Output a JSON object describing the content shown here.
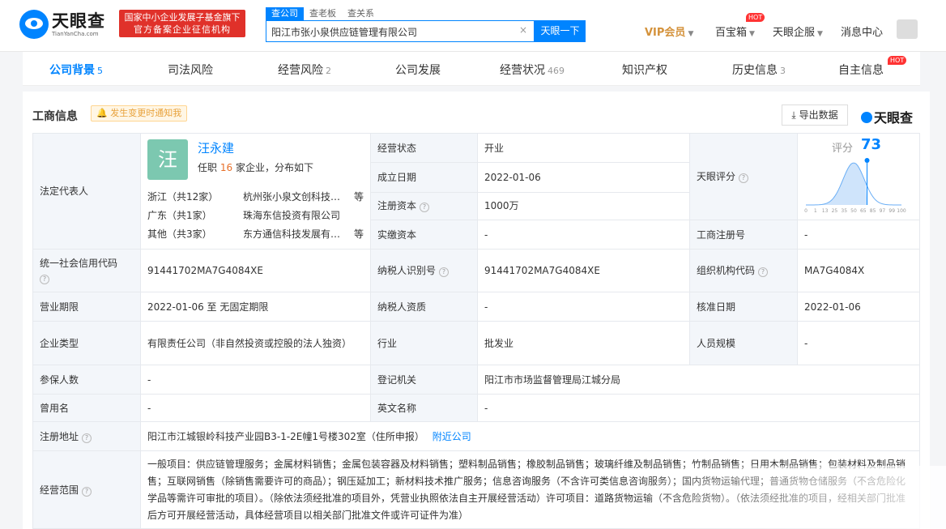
{
  "header": {
    "logo_text": "天眼查",
    "logo_sub": "TianYanCha.com",
    "badge_line1": "国家中小企业发展子基金旗下",
    "badge_line2": "官方备案企业征信机构",
    "search_tabs": [
      "查公司",
      "查老板",
      "查关系"
    ],
    "search_value": "阳江市张小泉供应链管理有限公司",
    "search_clear": "×",
    "search_button": "天眼一下",
    "vip": "VIP会员",
    "baibaoxiang": "百宝箱",
    "hot": "HOT",
    "qiye": "天眼企服",
    "messages": "消息中心"
  },
  "tabs": [
    {
      "label": "公司背景",
      "count": "5"
    },
    {
      "label": "司法风险",
      "count": ""
    },
    {
      "label": "经营风险",
      "count": "2"
    },
    {
      "label": "公司发展",
      "count": ""
    },
    {
      "label": "经营状况",
      "count": "469"
    },
    {
      "label": "知识产权",
      "count": ""
    },
    {
      "label": "历史信息",
      "count": "3"
    },
    {
      "label": "自主信息",
      "count": ""
    }
  ],
  "section": {
    "title": "工商信息",
    "notify": "发生变更时通知我",
    "export": "导出数据",
    "brand": "天眼查"
  },
  "legal": {
    "label": "法定代表人",
    "avatar_char": "汪",
    "name": "汪永建",
    "sub_prefix": "任职",
    "sub_count": "16",
    "sub_suffix": "家企业，分布如下",
    "rows": [
      {
        "region": "浙江（共12家）",
        "company": "杭州张小泉文创科技有限公司",
        "etc": "等"
      },
      {
        "region": "广东（共1家）",
        "company": "珠海东信投资有限公司",
        "etc": ""
      },
      {
        "region": "其他（共3家）",
        "company": "东方通信科技发展有限公司",
        "etc": "等"
      }
    ]
  },
  "score": {
    "label": "天眼评分",
    "title": "评分",
    "value": 73,
    "ticks": [
      "0",
      "1",
      "13",
      "25",
      "35",
      "50",
      "65",
      "85",
      "97",
      "99",
      "100"
    ]
  },
  "fields": {
    "status_l": "经营状态",
    "status_v": "开业",
    "founded_l": "成立日期",
    "founded_v": "2022-01-06",
    "capital_l": "注册资本",
    "capital_v": "1000万",
    "paid_l": "实缴资本",
    "paid_v": "-",
    "regno_l": "工商注册号",
    "regno_v": "-",
    "credit_l": "统一社会信用代码",
    "credit_v": "91441702MA7G4084XE",
    "taxid_l": "纳税人识别号",
    "taxid_v": "91441702MA7G4084XE",
    "org_l": "组织机构代码",
    "org_v": "MA7G4084X",
    "term_l": "营业期限",
    "term_v": "2022-01-06 至 无固定期限",
    "taxq_l": "纳税人资质",
    "taxq_v": "-",
    "approve_l": "核准日期",
    "approve_v": "2022-01-06",
    "type_l": "企业类型",
    "type_v": "有限责任公司（非自然投资或控股的法人独资）",
    "industry_l": "行业",
    "industry_v": "批发业",
    "staff_l": "人员规模",
    "staff_v": "-",
    "insured_l": "参保人数",
    "insured_v": "-",
    "regauth_l": "登记机关",
    "regauth_v": "阳江市市场监督管理局江城分局",
    "former_l": "曾用名",
    "former_v": "-",
    "en_l": "英文名称",
    "en_v": "-",
    "addr_l": "注册地址",
    "addr_v": "阳江市江城银岭科技产业园B3-1-2E幢1号楼302室（住所申报）",
    "addr_link": "附近公司",
    "scope_l": "经营范围",
    "scope_v": "一般项目：供应链管理服务；金属材料销售；金属包装容器及材料销售；塑料制品销售；橡胶制品销售；玻璃纤维及制品销售；竹制品销售；日用木制品销售；包装材料及制品销售；互联网销售（除销售需要许可的商品）；钢压延加工；新材料技术推广服务；信息咨询服务（不含许可类信息咨询服务）；国内货物运输代理；普通货物仓储服务（不含危险化学品等需许可审批的项目）。（除依法须经批准的项目外，凭营业执照依法自主开展经营活动）许可项目：道路货物运输（不含危险货物）。（依法须经批准的项目，经相关部门批准后方可开展经营活动，具体经营项目以相关部门批准文件或许可证件为准）"
  }
}
